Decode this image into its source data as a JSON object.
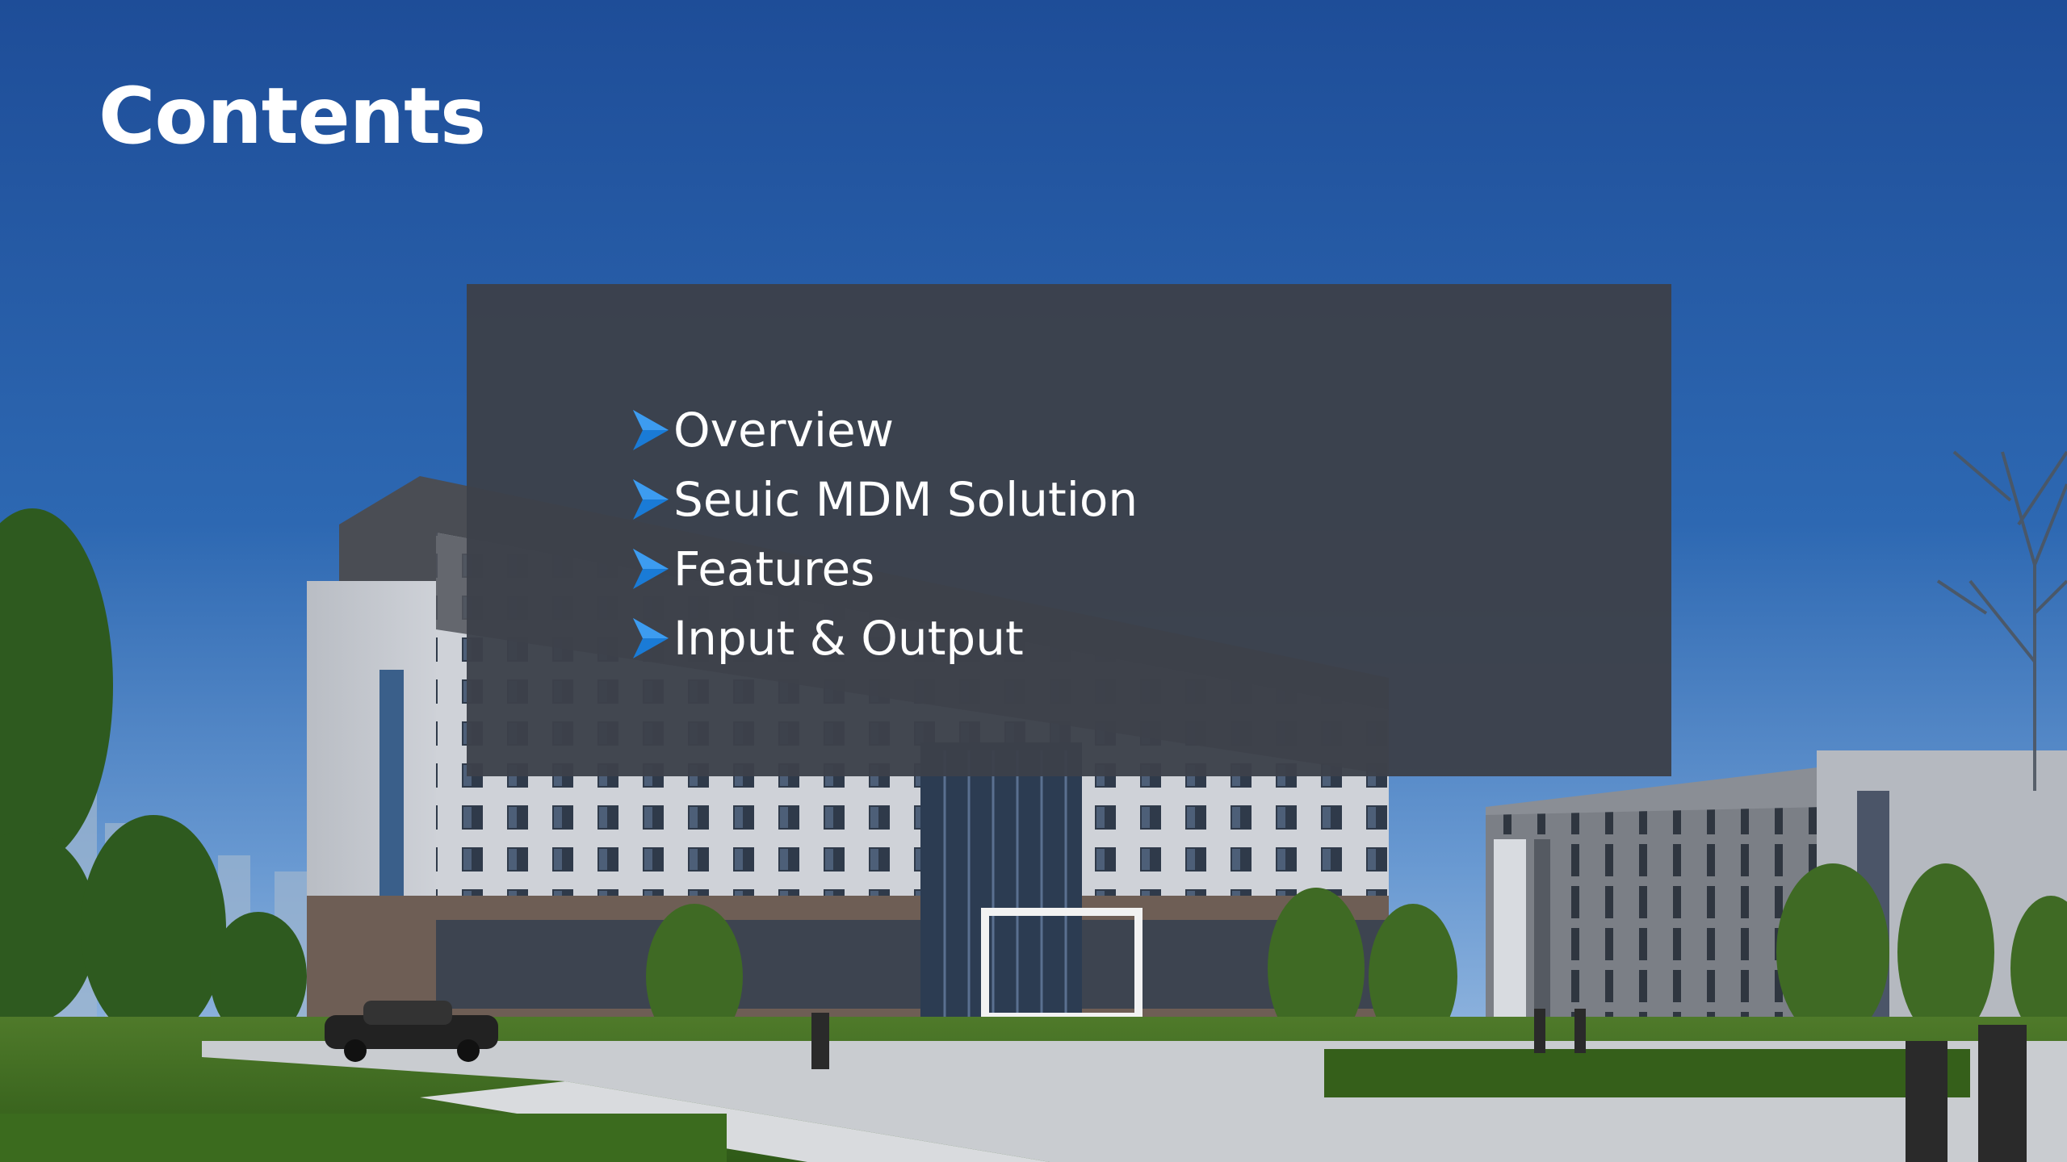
{
  "slide": {
    "title": "Contents",
    "items": [
      {
        "label": "Overview",
        "icon": "arrow-bullet-icon"
      },
      {
        "label": "Seuic MDM Solution",
        "icon": "arrow-bullet-icon"
      },
      {
        "label": "Features",
        "icon": "arrow-bullet-icon"
      },
      {
        "label": "Input & Output",
        "icon": "arrow-bullet-icon"
      }
    ]
  },
  "colors": {
    "sky_top": "#1f4f9a",
    "sky_bottom": "#7faad8",
    "panel": "#3c414a",
    "bullet_accent": "#1a7bd6",
    "text": "#ffffff"
  }
}
